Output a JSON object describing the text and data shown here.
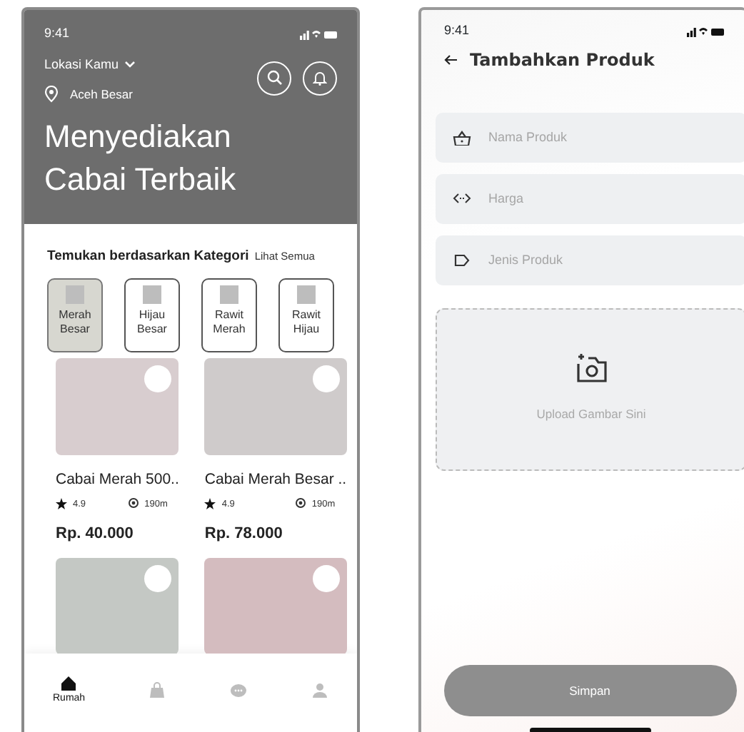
{
  "left_screen": {
    "status_bar": {
      "time": "9:41"
    },
    "location_label": "Lokasi Kamu",
    "location": "Aceh Besar",
    "headline": [
      "Menyediakan",
      "Cabai Terbaik"
    ],
    "section_title": "Temukan berdasarkan Kategori",
    "see_all": "Lihat Semua",
    "categories": [
      {
        "label": "Merah Besar",
        "selected": true
      },
      {
        "label": "Hijau Besar",
        "selected": false
      },
      {
        "label": "Rawit Merah",
        "selected": false
      },
      {
        "label": "Rawit Hijau",
        "selected": false
      }
    ],
    "products": [
      {
        "name": "Cabai Merah 500..",
        "rating": "4.9",
        "distance": "190m",
        "price": "Rp. 40.000",
        "color": "#d8cdcf"
      },
      {
        "name": "Cabai Merah Besar ..",
        "rating": "4.9",
        "distance": "190m",
        "price": "Rp. 78.000",
        "color": "#cfcbcb"
      },
      {
        "color": "#c4c8c4"
      },
      {
        "color": "#d4bcbf"
      }
    ],
    "nav": [
      {
        "kind": "home",
        "label": "Rumah",
        "selected": true
      },
      {
        "kind": "bag",
        "selected": false
      },
      {
        "kind": "chat",
        "selected": false
      },
      {
        "kind": "user",
        "selected": false
      }
    ]
  },
  "right_screen": {
    "status_bar": {
      "time": "9:41"
    },
    "title": "Tambahkan Produk",
    "fields": [
      {
        "kind": "basket",
        "placeholder": "Nama Produk"
      },
      {
        "kind": "code",
        "placeholder": "Harga"
      },
      {
        "kind": "tag",
        "placeholder": "Jenis Produk"
      }
    ],
    "upload_label": "Upload Gambar Sini",
    "save_button": "Simpan"
  }
}
